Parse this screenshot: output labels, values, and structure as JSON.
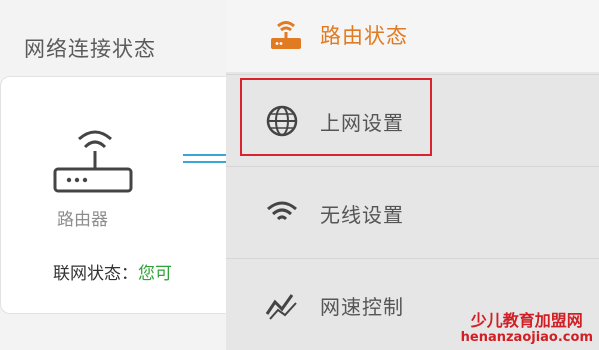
{
  "left_panel": {
    "title": "网络连接状态",
    "router_label": "路由器",
    "status_label": "联网状态：",
    "status_value": "您可"
  },
  "menu": {
    "header": {
      "label": "路由状态",
      "icon": "router-icon"
    },
    "items": [
      {
        "label": "上网设置",
        "icon": "globe-icon",
        "highlighted": true
      },
      {
        "label": "无线设置",
        "icon": "wifi-icon"
      },
      {
        "label": "网速控制",
        "icon": "speed-graph-icon"
      }
    ]
  },
  "colors": {
    "accent_orange": "#e07b22",
    "status_green": "#2fa33a",
    "highlight_red": "#d9232e",
    "line_blue": "#3aa6d6"
  },
  "watermark": {
    "line1": "少儿教育加盟网",
    "line2": "henanzaojiao.com"
  }
}
